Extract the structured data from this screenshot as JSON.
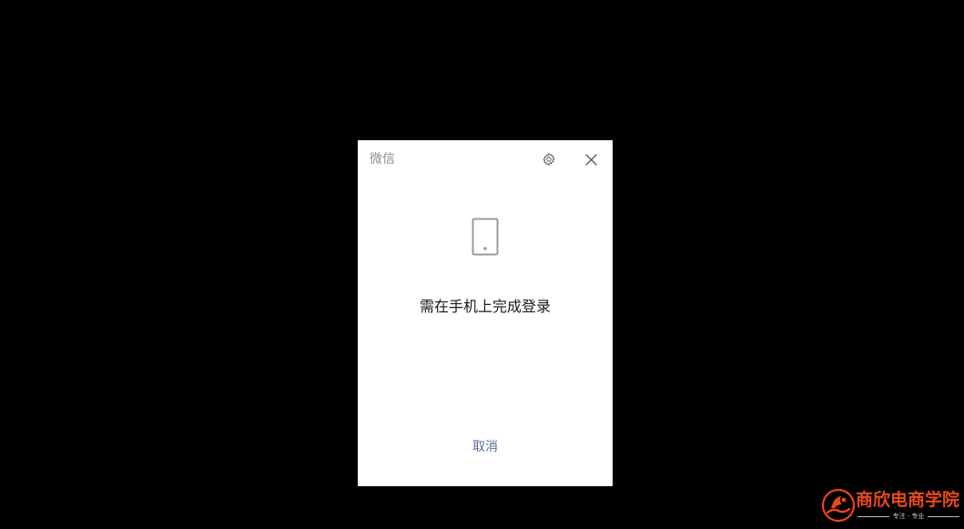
{
  "window": {
    "title": "微信"
  },
  "icons": {
    "settings": "gear-icon",
    "close": "close-icon",
    "device": "phone-icon"
  },
  "main": {
    "message": "需在手机上完成登录",
    "cancel_label": "取消"
  },
  "watermark": {
    "name": "商欣电商学院",
    "tagline": "专注 · 专业"
  },
  "colors": {
    "background": "#000000",
    "dialog": "#ffffff",
    "title_text": "#8c8c8c",
    "message_text": "#1a1a1a",
    "link": "#576b95",
    "watermark": "#e8481c"
  }
}
